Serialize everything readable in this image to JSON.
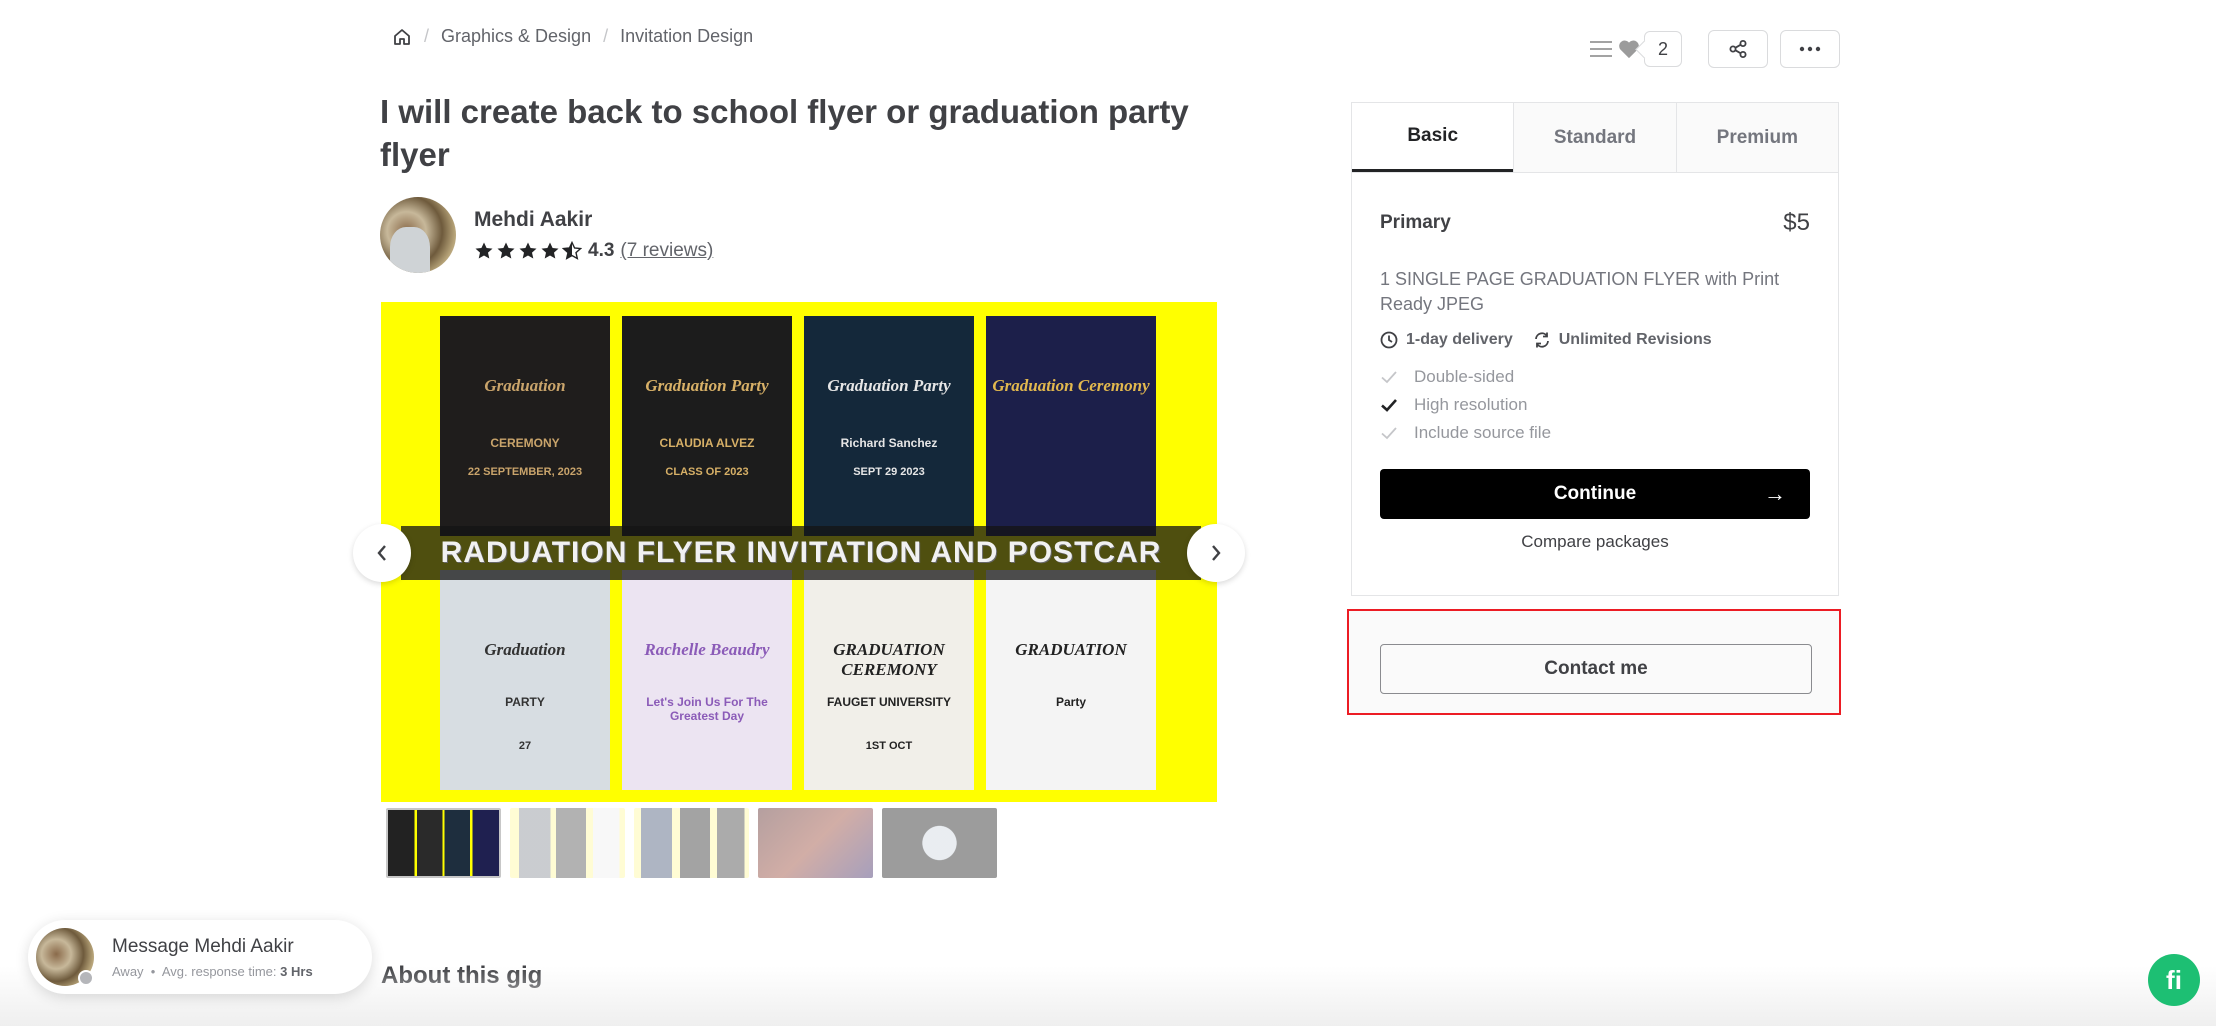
{
  "breadcrumb": {
    "home_icon": "home-icon",
    "items": [
      "Graphics & Design",
      "Invitation Design"
    ],
    "separator": "/"
  },
  "top_actions": {
    "list_icon": "list-icon",
    "heart_icon": "heart-icon",
    "likes_count": "2",
    "share_icon": "share-icon",
    "more_icon": "more-icon"
  },
  "gig": {
    "title": "I will create back to school flyer or graduation party flyer"
  },
  "seller": {
    "name": "Mehdi Aakir",
    "rating": "4.3",
    "rating_stars": 4.5,
    "reviews_label": "(7 reviews)"
  },
  "gallery": {
    "banner_text": "RADUATION FLYER INVITATION AND POSTCAR",
    "prev_icon": "chevron-left-icon",
    "next_icon": "chevron-right-icon",
    "flyers": [
      {
        "title": "Graduation",
        "subtitle": "CEREMONY",
        "detail": "22 SEPTEMBER, 2023",
        "bg": "#1f1d1c",
        "fg": "#c9a46b"
      },
      {
        "title": "Graduation Party",
        "subtitle": "CLAUDIA ALVEZ",
        "detail": "CLASS OF 2023",
        "bg": "#1c1c1c",
        "fg": "#d7b067"
      },
      {
        "title": "Graduation Party",
        "subtitle": "Richard Sanchez",
        "detail": "SEPT 29 2023",
        "bg": "#14283a",
        "fg": "#e6e6e6"
      },
      {
        "title": "Graduation Ceremony",
        "subtitle": "",
        "detail": "",
        "bg": "#1c1f4a",
        "fg": "#e2b84e"
      },
      {
        "title": "Graduation",
        "subtitle": "PARTY",
        "detail": "27",
        "bg": "#d7dde2",
        "fg": "#333"
      },
      {
        "title": "Rachelle Beaudry",
        "subtitle": "Let's Join Us For The Greatest Day",
        "detail": "",
        "bg": "#ece4f2",
        "fg": "#8b5bb8"
      },
      {
        "title": "GRADUATION CEREMONY",
        "subtitle": "FAUGET UNIVERSITY",
        "detail": "1ST OCT",
        "bg": "#f1efe9",
        "fg": "#222"
      },
      {
        "title": "GRADUATION",
        "subtitle": "Party",
        "detail": "",
        "bg": "#f4f4f4",
        "fg": "#222"
      }
    ],
    "thumbnail_count": 5,
    "active_thumbnail": 0
  },
  "package": {
    "tabs": [
      "Basic",
      "Standard",
      "Premium"
    ],
    "active_tab": 0,
    "name": "Primary",
    "price": "$5",
    "description": "1 SINGLE PAGE GRADUATION FLYER with Print Ready JPEG",
    "delivery": "1-day delivery",
    "revisions": "Unlimited Revisions",
    "features": [
      {
        "label": "Double-sided",
        "included": false
      },
      {
        "label": "High resolution",
        "included": true
      },
      {
        "label": "Include source file",
        "included": false
      }
    ],
    "continue_label": "Continue",
    "continue_arrow": "→",
    "compare_label": "Compare packages"
  },
  "contact": {
    "button_label": "Contact me",
    "highlight_color": "#ec1c24"
  },
  "about": {
    "title": "About this gig"
  },
  "message_bubble": {
    "title": "Message Mehdi Aakir",
    "status": "Away",
    "separator": "•",
    "response_label": "Avg. response time:",
    "response_value": "3 Hrs"
  },
  "chat_button": {
    "label": "fi",
    "color": "#1dbf73"
  }
}
